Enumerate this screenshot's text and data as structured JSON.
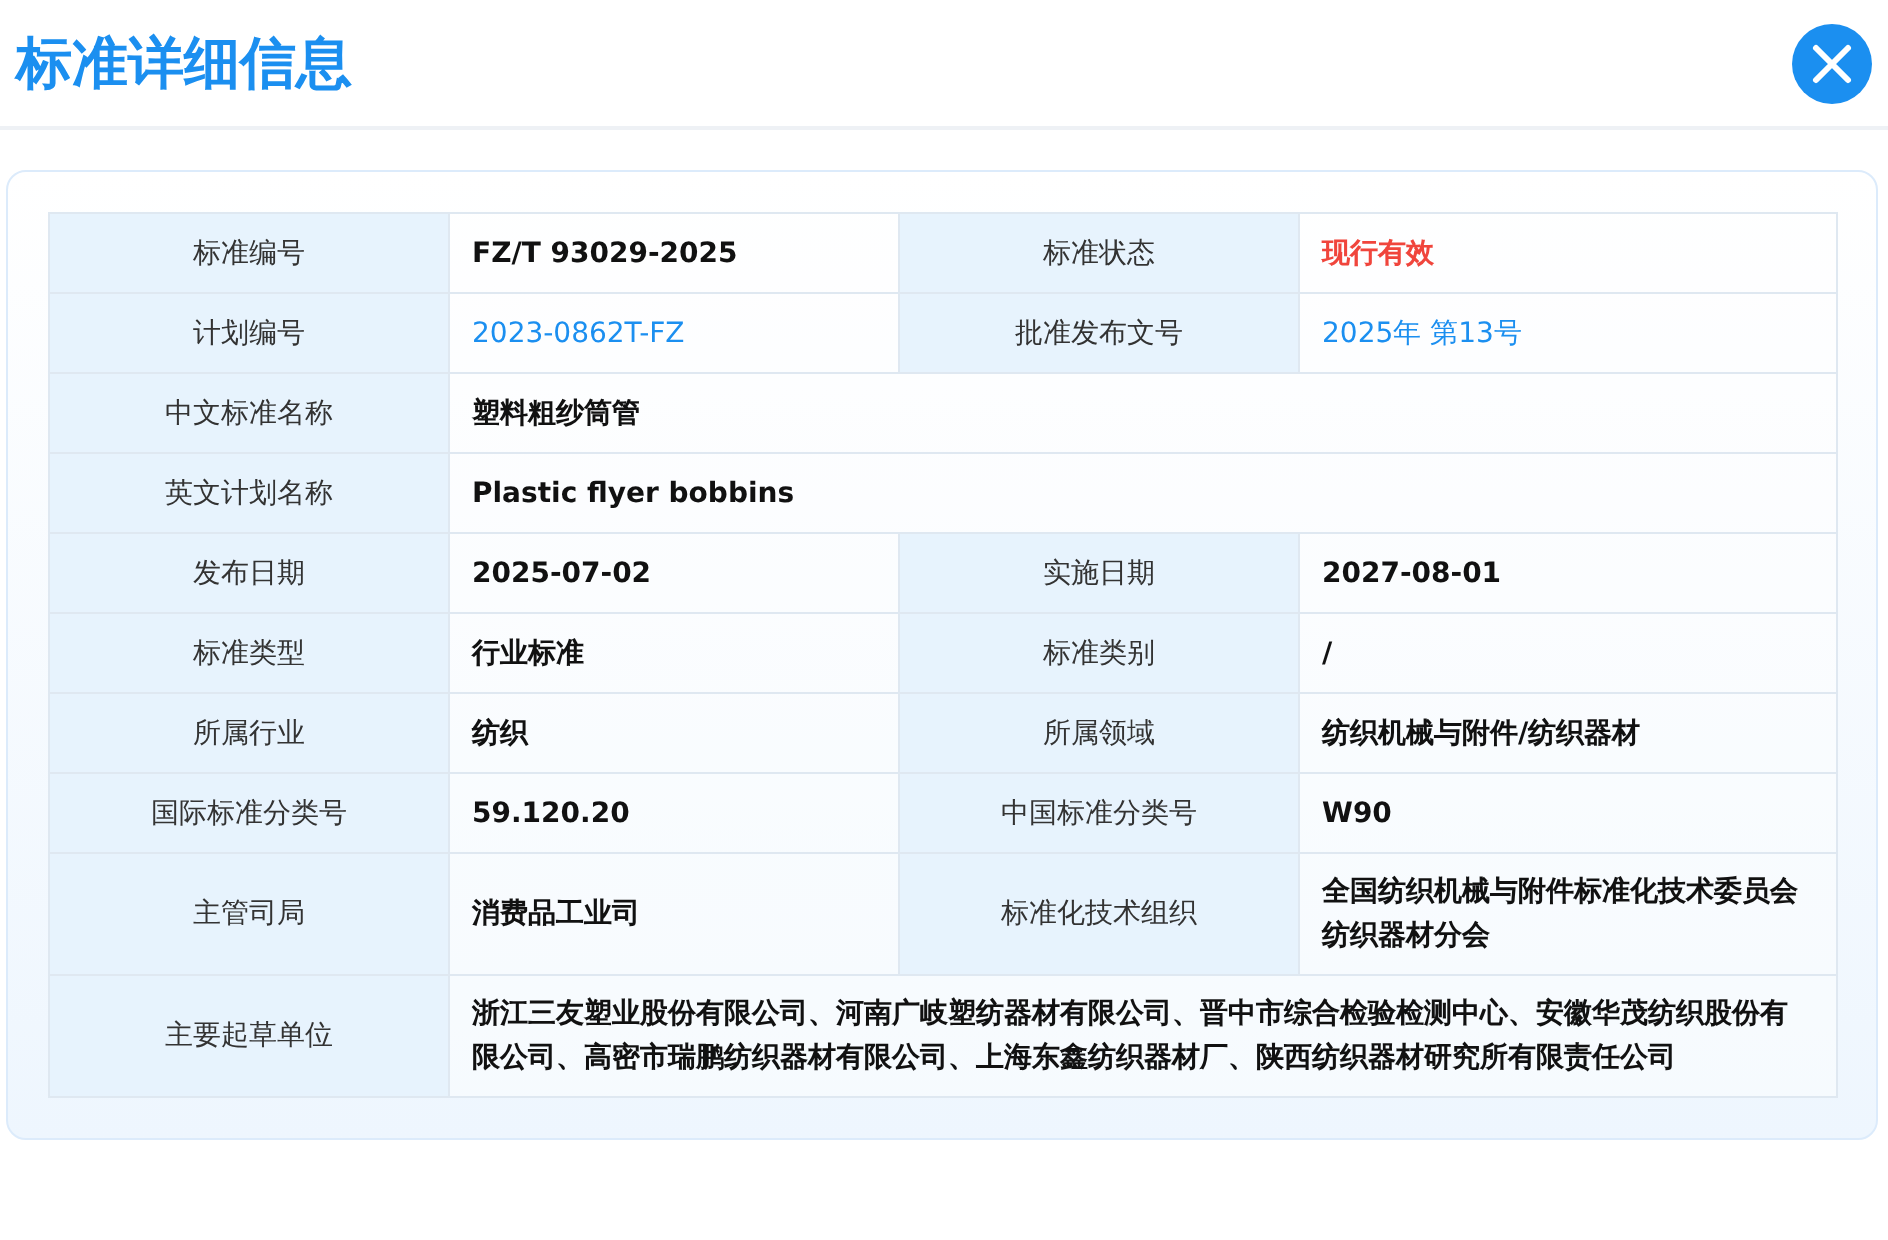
{
  "dialog": {
    "title": "标准详细信息"
  },
  "rows": [
    {
      "cells": [
        {
          "kind": "label",
          "text": "标准编号"
        },
        {
          "kind": "value",
          "text": "FZ/T 93029-2025"
        },
        {
          "kind": "label",
          "text": "标准状态"
        },
        {
          "kind": "status",
          "text": "现行有效"
        }
      ]
    },
    {
      "cells": [
        {
          "kind": "label",
          "text": "计划编号"
        },
        {
          "kind": "link",
          "text": "2023-0862T-FZ"
        },
        {
          "kind": "label",
          "text": "批准发布文号"
        },
        {
          "kind": "link",
          "text": "2025年 第13号"
        }
      ]
    },
    {
      "cells": [
        {
          "kind": "label",
          "text": "中文标准名称"
        },
        {
          "kind": "value",
          "wide": true,
          "text": "塑料粗纱筒管"
        }
      ]
    },
    {
      "cells": [
        {
          "kind": "label",
          "text": "英文计划名称"
        },
        {
          "kind": "value",
          "wide": true,
          "text": "Plastic flyer bobbins"
        }
      ]
    },
    {
      "cells": [
        {
          "kind": "label",
          "text": "发布日期"
        },
        {
          "kind": "value",
          "text": "2025-07-02"
        },
        {
          "kind": "label",
          "text": "实施日期"
        },
        {
          "kind": "value",
          "text": "2027-08-01"
        }
      ]
    },
    {
      "cells": [
        {
          "kind": "label",
          "text": "标准类型"
        },
        {
          "kind": "value",
          "text": "行业标准"
        },
        {
          "kind": "label",
          "text": "标准类别"
        },
        {
          "kind": "value",
          "text": "/"
        }
      ]
    },
    {
      "cells": [
        {
          "kind": "label",
          "text": "所属行业"
        },
        {
          "kind": "value",
          "text": "纺织"
        },
        {
          "kind": "label",
          "text": "所属领域"
        },
        {
          "kind": "value",
          "text": "纺织机械与附件/纺织器材"
        }
      ]
    },
    {
      "cells": [
        {
          "kind": "label",
          "text": "国际标准分类号"
        },
        {
          "kind": "value",
          "text": "59.120.20"
        },
        {
          "kind": "label",
          "text": "中国标准分类号"
        },
        {
          "kind": "value",
          "text": "W90"
        }
      ]
    },
    {
      "cells": [
        {
          "kind": "label",
          "text": "主管司局"
        },
        {
          "kind": "value",
          "text": "消费品工业司"
        },
        {
          "kind": "label",
          "text": "标准化技术组织"
        },
        {
          "kind": "value",
          "text": "全国纺织机械与附件标准化技术委员会纺织器材分会"
        }
      ]
    },
    {
      "cells": [
        {
          "kind": "label",
          "text": "主要起草单位"
        },
        {
          "kind": "value",
          "wide": true,
          "text": "浙江三友塑业股份有限公司、河南广岐塑纺器材有限公司、晋中市综合检验检测中心、安徽华茂纺织股份有限公司、高密市瑞鹏纺织器材有限公司、上海东鑫纺织器材厂、陕西纺织器材研究所有限责任公司"
        }
      ]
    }
  ]
}
